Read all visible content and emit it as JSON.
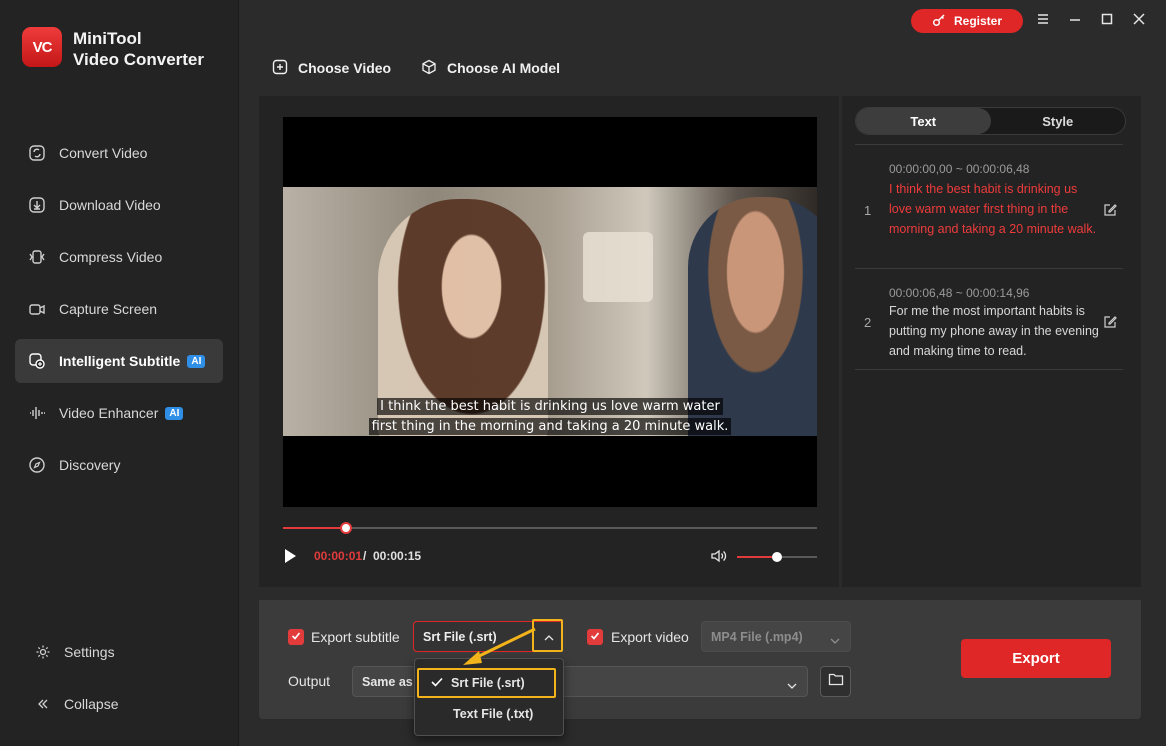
{
  "app": {
    "logo_text": "VC",
    "name_line1": "MiniTool",
    "name_line2": "Video Converter",
    "register_label": "Register"
  },
  "sidebar": {
    "items": [
      {
        "label": "Convert Video",
        "icon": "convert-icon"
      },
      {
        "label": "Download Video",
        "icon": "download-icon"
      },
      {
        "label": "Compress Video",
        "icon": "compress-icon"
      },
      {
        "label": "Capture Screen",
        "icon": "camera-icon"
      },
      {
        "label": "Intelligent Subtitle",
        "icon": "subtitle-icon",
        "badge": "AI",
        "active": true
      },
      {
        "label": "Video Enhancer",
        "icon": "waveform-icon",
        "badge": "AI"
      },
      {
        "label": "Discovery",
        "icon": "compass-icon"
      }
    ],
    "settings_label": "Settings",
    "collapse_label": "Collapse"
  },
  "toolbar": {
    "choose_video": "Choose Video",
    "choose_ai_model": "Choose AI Model"
  },
  "player": {
    "subtitle_line1": "I think the best habit is drinking us love warm water",
    "subtitle_line2": "first thing in the morning and taking a 20 minute walk.",
    "current_time": "00:00:01",
    "separator": "/",
    "total_time": "00:00:15",
    "progress_fraction": 0.118,
    "volume_fraction": 0.5
  },
  "subtitles_panel": {
    "tabs": [
      {
        "label": "Text",
        "active": true
      },
      {
        "label": "Style",
        "active": false
      }
    ],
    "items": [
      {
        "index": "1",
        "time": "00:00:00,00 ~ 00:00:06,48",
        "text": "I think the best habit is drinking us love warm water first thing in the morning and taking a 20 minute walk.",
        "highlighted": true
      },
      {
        "index": "2",
        "time": "00:00:06,48 ~ 00:00:14,96",
        "text": "For me the most important habits is putting my phone away in the evening and making time to read.",
        "highlighted": false
      }
    ]
  },
  "export": {
    "export_subtitle_label": "Export subtitle",
    "subtitle_format": "Srt File (.srt)",
    "export_video_label": "Export video",
    "video_format": "MP4 File (.mp4)",
    "output_label": "Output",
    "output_value": "Same as",
    "export_button": "Export",
    "dropdown_options": [
      "Srt File (.srt)",
      "Text File (.txt)"
    ]
  },
  "colors": {
    "accent": "#e02727",
    "highlight": "#f3b31a",
    "ai_badge": "#2f8fe6"
  }
}
